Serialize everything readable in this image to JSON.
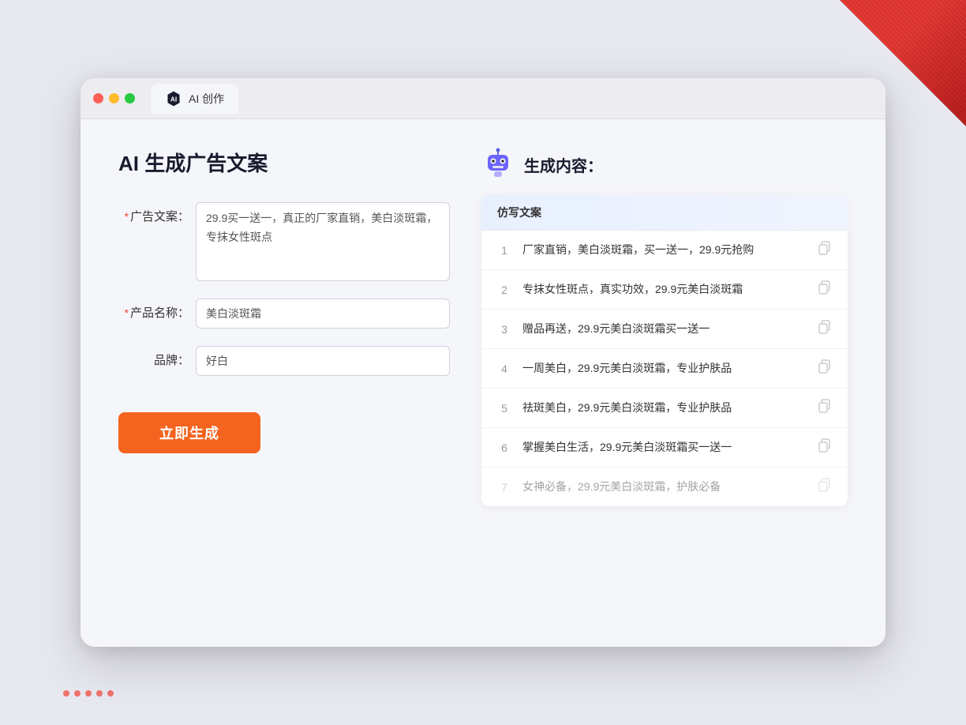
{
  "browser": {
    "tab_label": "AI 创作"
  },
  "page": {
    "title": "AI 生成广告文案",
    "form": {
      "ad_copy_label": "广告文案：",
      "ad_copy_required": "*",
      "ad_copy_value": "29.9买一送一，真正的厂家直销，美白淡斑霜，专抹女性斑点",
      "product_name_label": "产品名称：",
      "product_name_required": "*",
      "product_name_value": "美白淡斑霜",
      "brand_label": "品牌：",
      "brand_value": "好白",
      "generate_button_label": "立即生成"
    },
    "results": {
      "header_label": "生成内容：",
      "column_label": "仿写文案",
      "items": [
        {
          "num": "1",
          "text": "厂家直销，美白淡斑霜，买一送一，29.9元抢购",
          "dimmed": false
        },
        {
          "num": "2",
          "text": "专抹女性斑点，真实功效，29.9元美白淡斑霜",
          "dimmed": false
        },
        {
          "num": "3",
          "text": "赠品再送，29.9元美白淡斑霜买一送一",
          "dimmed": false
        },
        {
          "num": "4",
          "text": "一周美白，29.9元美白淡斑霜，专业护肤品",
          "dimmed": false
        },
        {
          "num": "5",
          "text": "祛斑美白，29.9元美白淡斑霜，专业护肤品",
          "dimmed": false
        },
        {
          "num": "6",
          "text": "掌握美白生活，29.9元美白淡斑霜买一送一",
          "dimmed": false
        },
        {
          "num": "7",
          "text": "女神必备，29.9元美白淡斑霜，护肤必备",
          "dimmed": true
        }
      ]
    }
  }
}
